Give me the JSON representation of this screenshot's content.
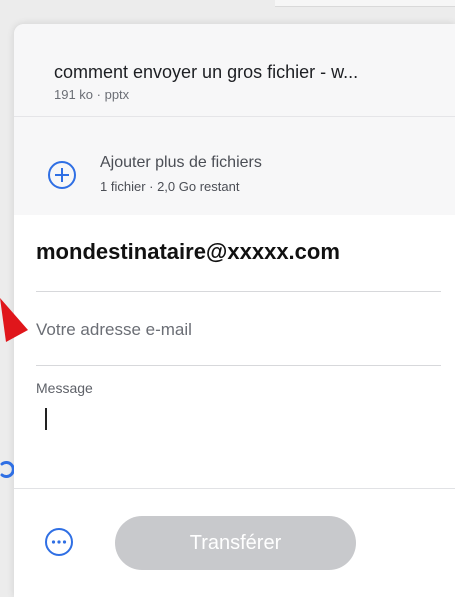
{
  "file": {
    "name": "comment envoyer un gros fichier - w...",
    "meta": "191 ko · pptx"
  },
  "add_files": {
    "label": "Ajouter plus de fichiers",
    "sub": "1 fichier · 2,0 Go restant"
  },
  "form": {
    "recipient": "mondestinataire@xxxxx.com",
    "email_placeholder": "Votre adresse e-mail",
    "message_label": "Message"
  },
  "actions": {
    "transfer_label": "Transférer"
  },
  "colors": {
    "accent": "#2f6fe4",
    "arrow": "#e0161b",
    "button_disabled": "#c8c9cc"
  },
  "icons": {
    "add": "plus-circle-icon",
    "more": "more-options-icon",
    "arrow": "red-arrow-icon",
    "loader": "spinner-icon"
  }
}
